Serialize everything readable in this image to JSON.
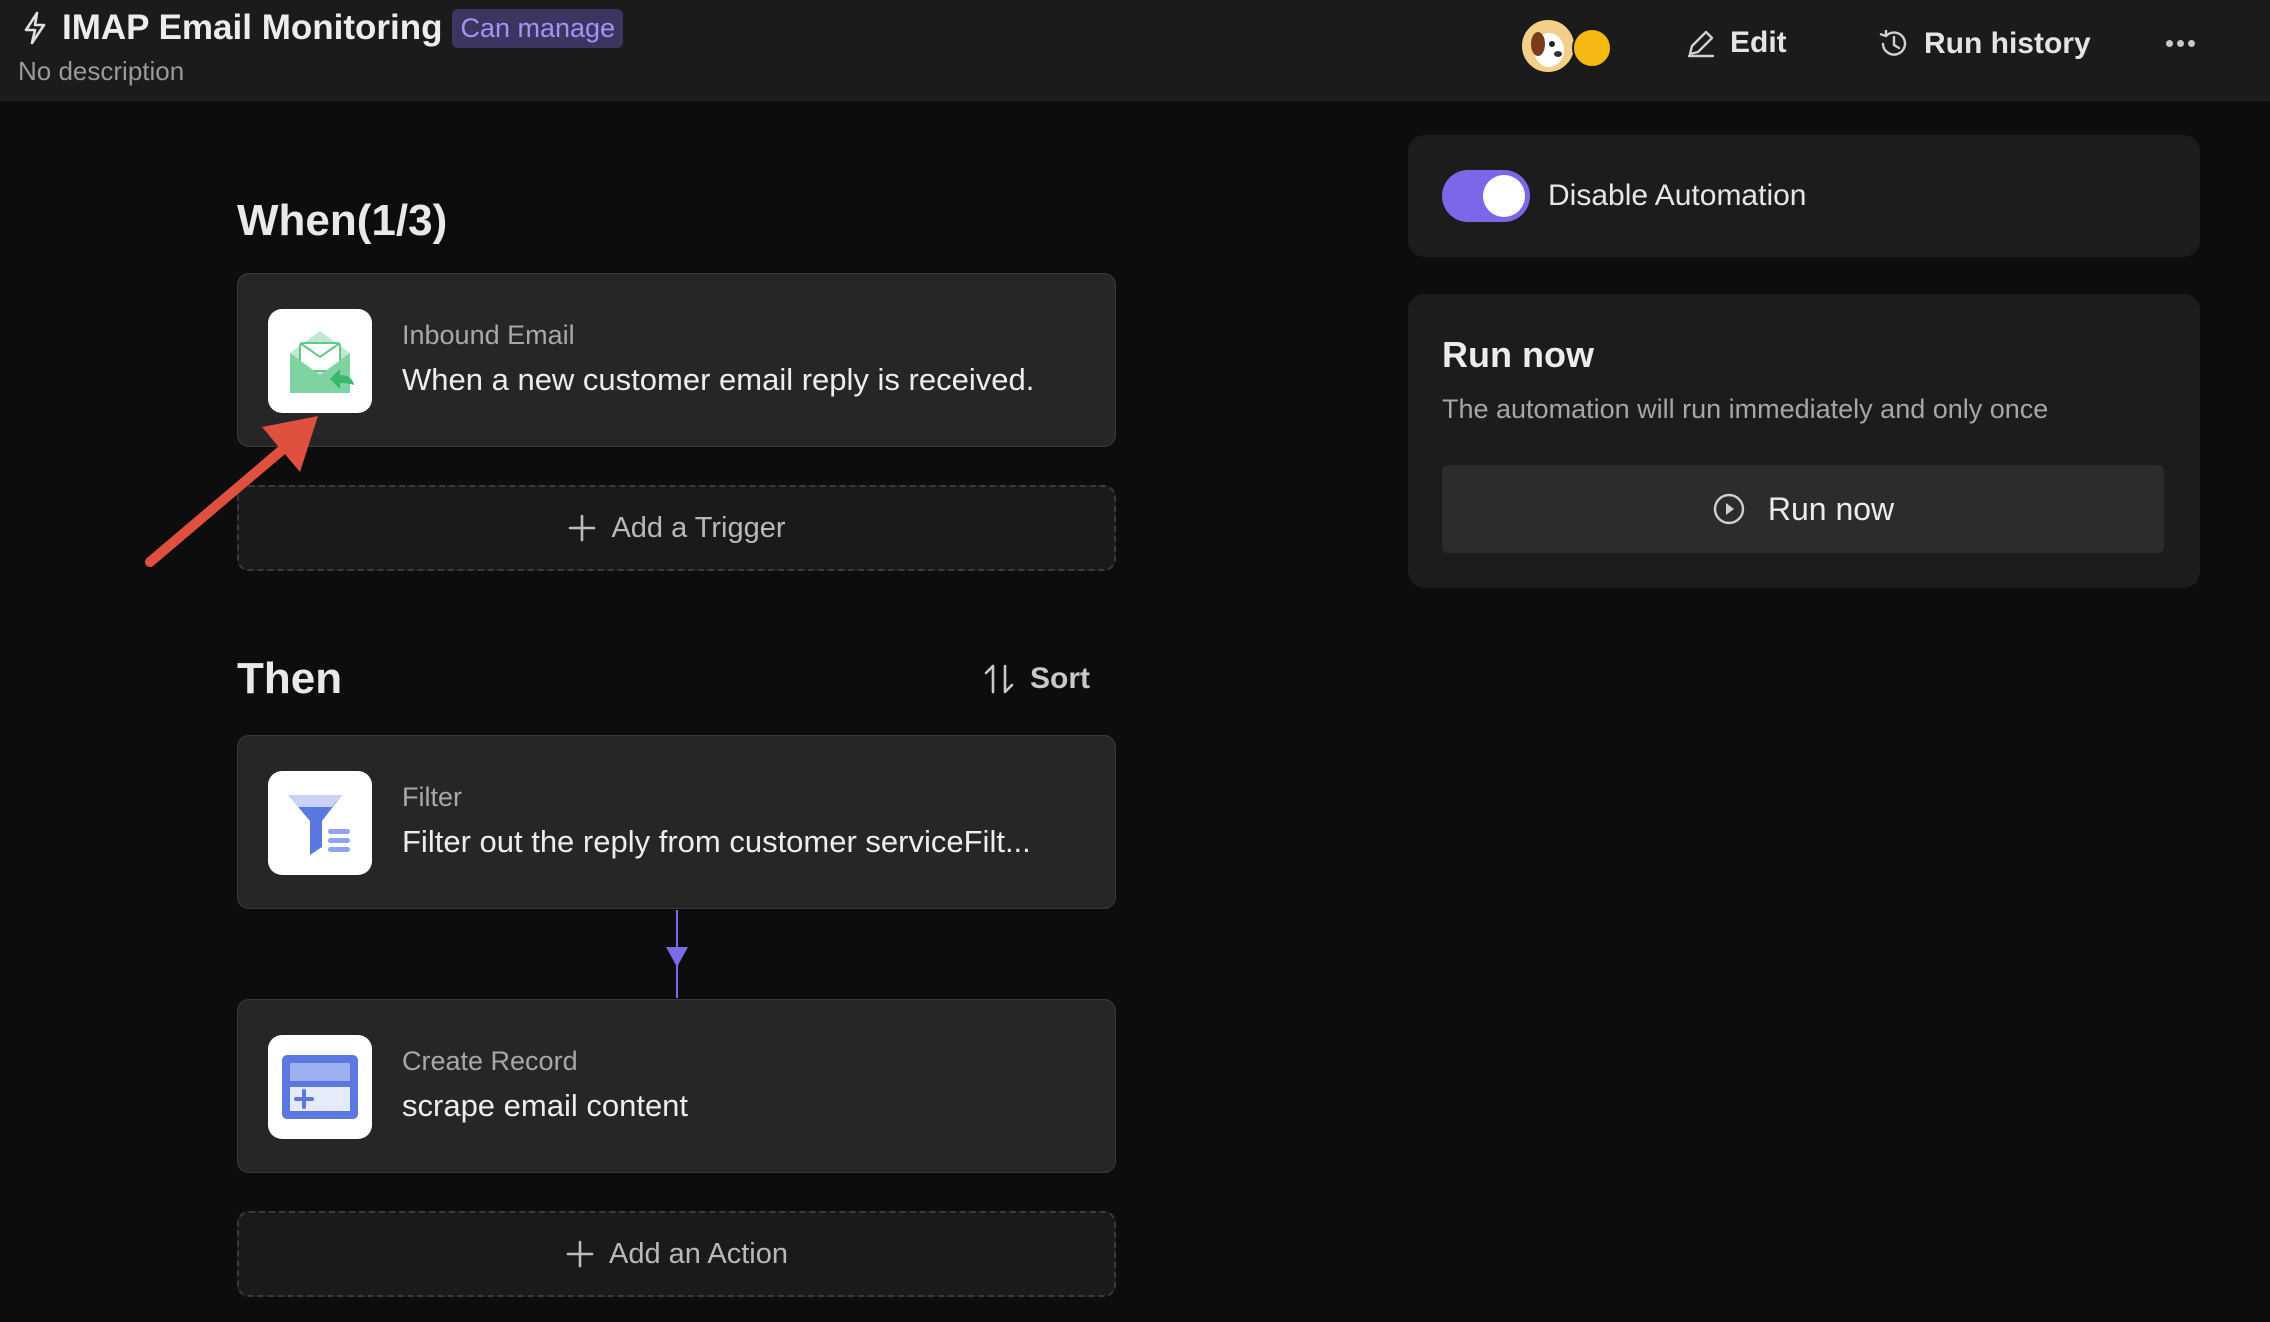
{
  "header": {
    "title": "IMAP Email Monitoring",
    "badge": "Can manage",
    "description": "No description",
    "edit_label": "Edit",
    "run_history_label": "Run history"
  },
  "when": {
    "title": "When(1/3)",
    "trigger": {
      "kicker": "Inbound Email",
      "text": "When a new customer email reply is received."
    },
    "add_label": "Add a Trigger"
  },
  "then": {
    "title": "Then",
    "sort_label": "Sort",
    "actions": [
      {
        "kicker": "Filter",
        "text": "Filter out the reply from customer serviceFilt..."
      },
      {
        "kicker": "Create Record",
        "text": "scrape email content"
      }
    ],
    "add_label": "Add an Action"
  },
  "automation_toggle": {
    "label": "Disable Automation",
    "enabled": true
  },
  "run_now": {
    "title": "Run now",
    "description": "The automation will run immediately and only once",
    "button_label": "Run now"
  },
  "colors": {
    "accent": "#7b68e8",
    "annotation_arrow": "#e0503f",
    "badge_text": "#9f95f2"
  },
  "icons": {
    "title": "bolt-icon",
    "edit": "pencil-icon",
    "history": "history-icon",
    "more": "more-dots-icon",
    "trigger": "inbound-email-icon",
    "filter": "filter-funnel-icon",
    "record": "create-record-icon",
    "add": "plus-icon",
    "sort": "sort-arrows-icon",
    "run": "play-circle-icon"
  }
}
